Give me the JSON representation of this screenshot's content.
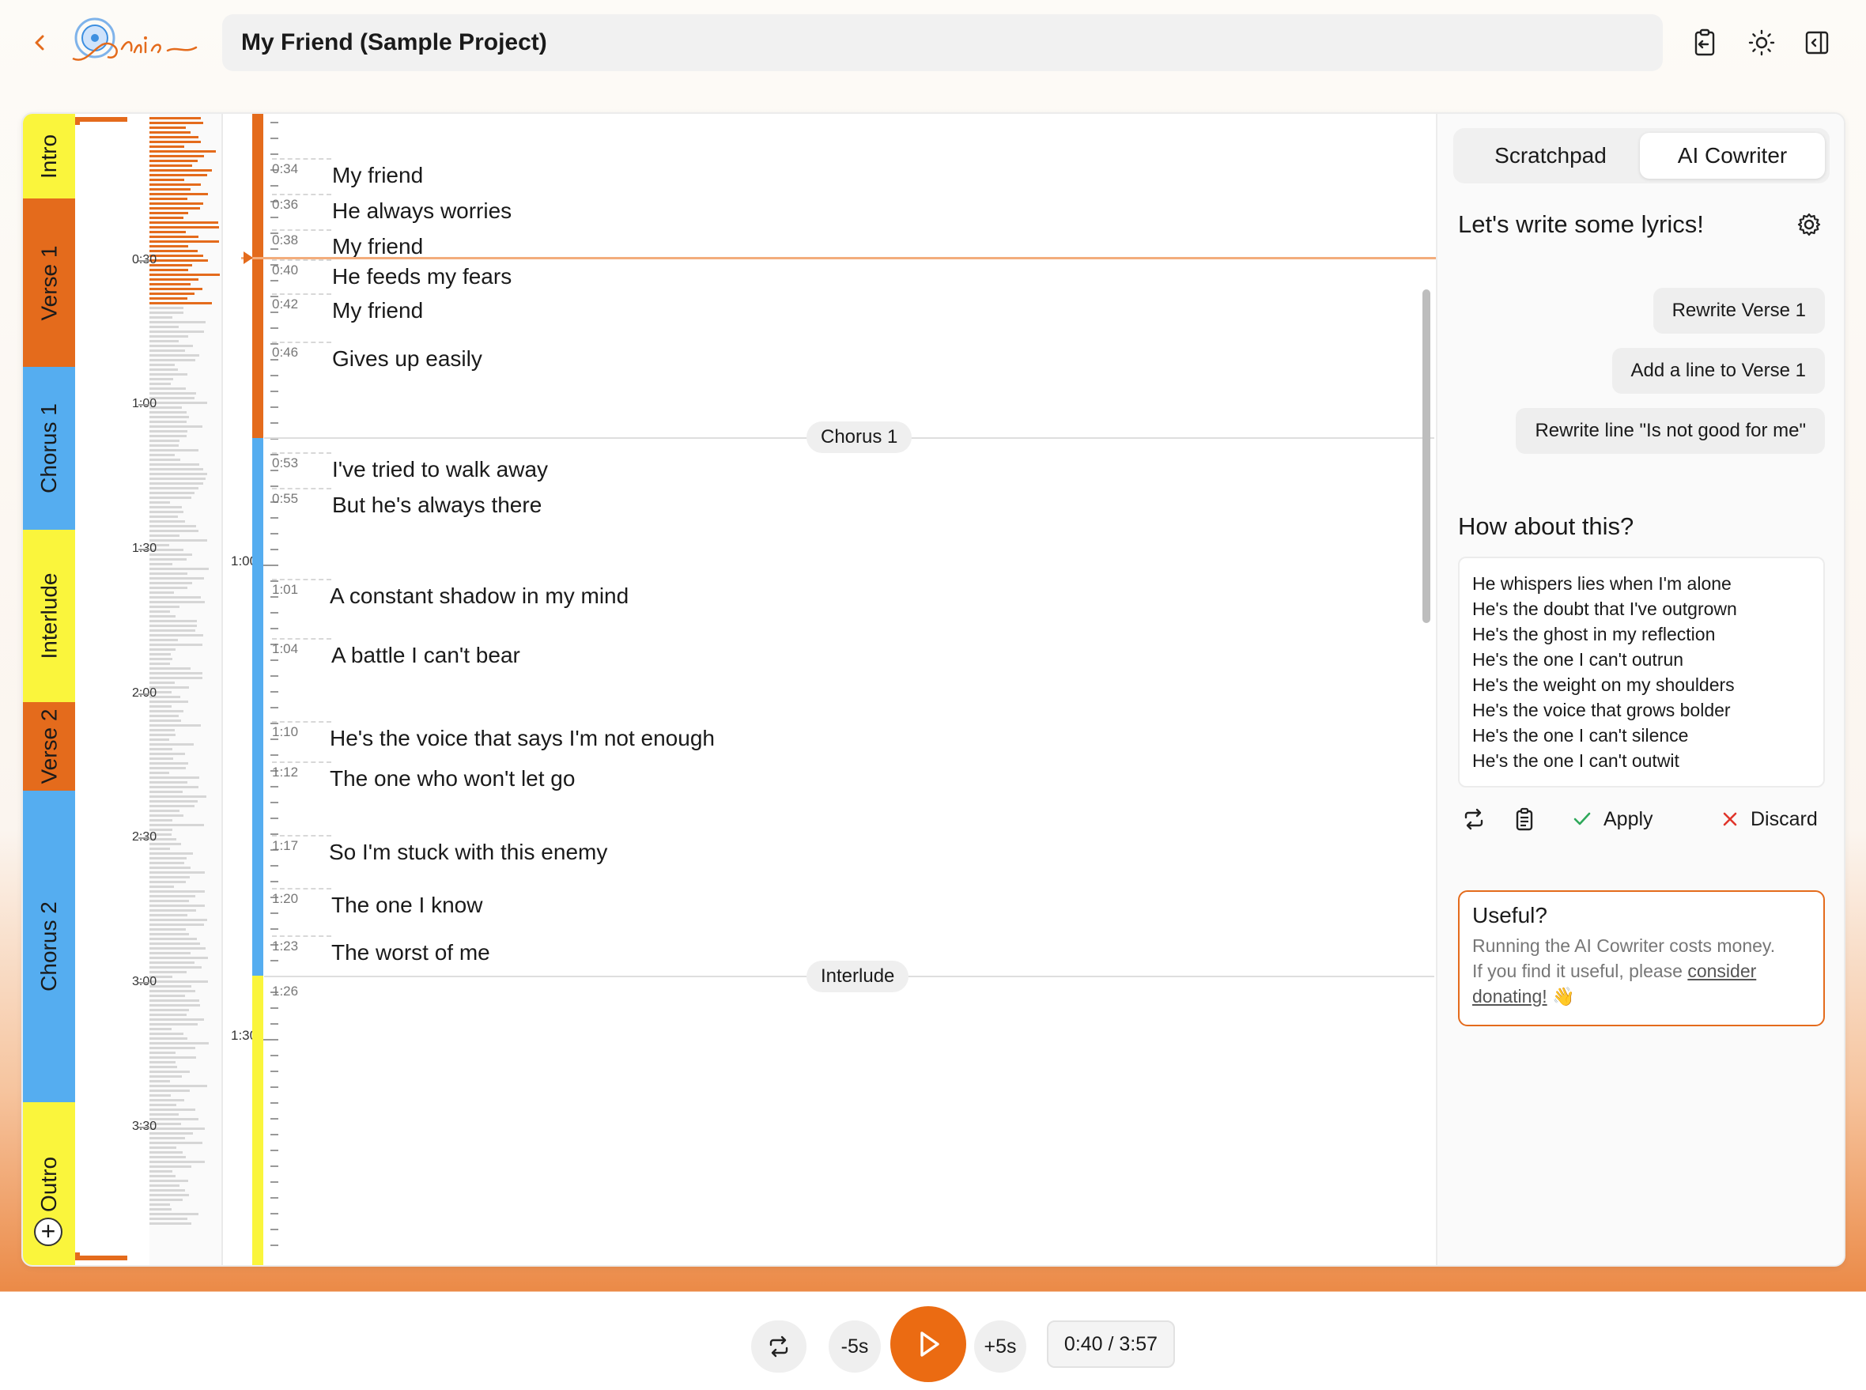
{
  "app": {
    "project_title": "My Friend (Sample Project)",
    "logo_text": "Lyrics"
  },
  "colors": {
    "accent": "#eb6b12",
    "verse": "#e46b1c",
    "chorus": "#55adf0",
    "intro_interlude_outro": "#faf53c"
  },
  "icons": {
    "back": "chevron-left-icon",
    "copy": "clipboard-icon",
    "theme": "sun-icon",
    "panel": "sidebar-toggle-icon",
    "settings": "gear-icon",
    "regenerate": "repeat-icon",
    "copy_result": "clipboard-list-icon",
    "apply": "check-icon",
    "discard": "x-icon",
    "loop": "repeat-icon",
    "play": "play-icon",
    "add": "plus-icon"
  },
  "sections": [
    {
      "label": "Intro",
      "color": "#faf53c"
    },
    {
      "label": "Verse 1",
      "color": "#e46b1c"
    },
    {
      "label": "Chorus 1",
      "color": "#55adf0"
    },
    {
      "label": "Interlude",
      "color": "#faf53c"
    },
    {
      "label": "Verse 2",
      "color": "#e46b1c"
    },
    {
      "label": "Chorus 2",
      "color": "#55adf0"
    },
    {
      "label": "Outro",
      "color": "#faf53c"
    }
  ],
  "overview_labels": [
    "0:30",
    "1:00",
    "1:30",
    "2:00",
    "2:30",
    "3:00",
    "3:30"
  ],
  "mini_labels": [
    "1:00",
    "1:30"
  ],
  "lyrics": [
    {
      "time": "0:34",
      "text": "My friend"
    },
    {
      "time": "0:36",
      "text": "He always worries"
    },
    {
      "time": "0:38",
      "text": "My friend"
    },
    {
      "time": "0:40",
      "text": "He feeds my fears"
    },
    {
      "time": "0:42",
      "text": "My friend"
    },
    {
      "time": "0:46",
      "text": "Gives up easily"
    },
    {
      "time": "0:53",
      "text": "I've tried to walk away"
    },
    {
      "time": "0:55",
      "text": "But he's always there"
    },
    {
      "time": "1:01",
      "text": "A constant shadow in my mind"
    },
    {
      "time": "1:04",
      "text": "A battle I can't bear"
    },
    {
      "time": "1:10",
      "text": "He's the voice that says I'm not enough"
    },
    {
      "time": "1:12",
      "text": "The one who won't let go"
    },
    {
      "time": "1:17",
      "text": "So I'm stuck with this enemy"
    },
    {
      "time": "1:20",
      "text": "The one I know"
    },
    {
      "time": "1:23",
      "text": "The worst of me"
    },
    {
      "time": "1:26",
      "text": ""
    }
  ],
  "section_pills": {
    "chorus1": "Chorus 1",
    "interlude": "Interlude"
  },
  "right_panel": {
    "tabs": [
      "Scratchpad",
      "AI Cowriter"
    ],
    "active_tab": "AI Cowriter",
    "heading": "Let's write some lyrics!",
    "suggestions": [
      "Rewrite Verse 1",
      "Add a line to Verse 1",
      "Rewrite line \"Is not good for me\""
    ],
    "result_heading": "How about this?",
    "result_lines": [
      "He whispers lies when I'm alone",
      "He's the doubt that I've outgrown",
      "He's the ghost in my reflection",
      "He's the one I can't outrun",
      "He's the weight on my shoulders",
      "He's the voice that grows bolder",
      "He's the one I can't silence",
      "He's the one I can't outwit"
    ],
    "apply_label": "Apply",
    "discard_label": "Discard",
    "useful": {
      "title": "Useful?",
      "body_1": "Running the AI Cowriter costs money.",
      "body_2": "If you find it useful, please ",
      "link": "consider donating!",
      "emoji": "👋"
    }
  },
  "player": {
    "back_label": "-5s",
    "fwd_label": "+5s",
    "time": "0:40 / 3:57",
    "position_fraction": 0.169
  }
}
